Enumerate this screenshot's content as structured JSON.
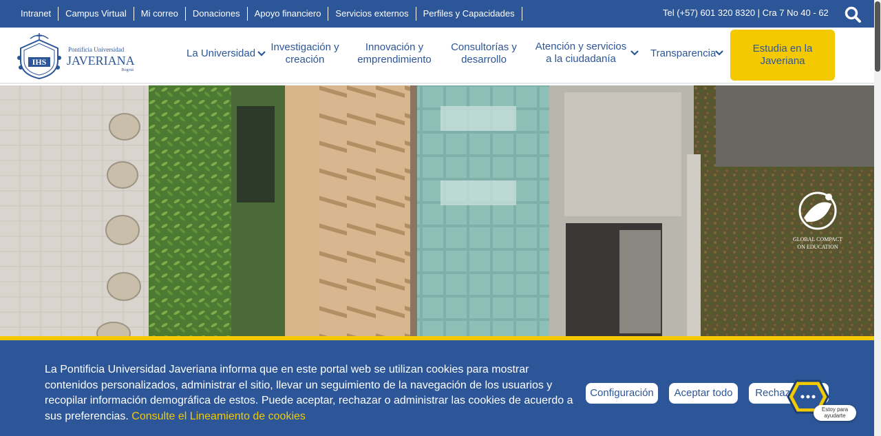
{
  "topbar": {
    "links": [
      "Intranet",
      "Campus Virtual",
      "Mi correo",
      "Donaciones",
      "Apoyo financiero",
      "Servicios externos",
      "Perfiles y Capacidades"
    ],
    "contact": "Tel (+57) 601 320 8320 | Cra 7 No 40 - 62",
    "search_icon": "search-icon"
  },
  "logo": {
    "line1": "Pontificia Universidad",
    "line2": "JAVERIANA",
    "line3": "Bogotá",
    "monogram": "IHS"
  },
  "nav": {
    "items": [
      {
        "label_1": "La Universidad",
        "label_2": "",
        "has_dropdown": true
      },
      {
        "label_1": "Investigación y",
        "label_2": "creación",
        "has_dropdown": false
      },
      {
        "label_1": "Innovación y",
        "label_2": "emprendimiento",
        "has_dropdown": false
      },
      {
        "label_1": "Consultorías y",
        "label_2": "desarrollo",
        "has_dropdown": false
      },
      {
        "label_1": "Atención y servicios",
        "label_2": "a la ciudadanía",
        "has_dropdown": true
      },
      {
        "label_1": "Transparencia",
        "label_2": "",
        "has_dropdown": true
      }
    ],
    "cta": "Estudia en la Javeriana"
  },
  "hero": {
    "badge_line1": "GLOBAL COMPACT",
    "badge_line2": "ON EDUCATION"
  },
  "cookie": {
    "text": "La Pontificia Universidad Javeriana informa que en este portal web se utilizan cookies para mostrar contenidos personalizados, administrar el sitio, llevar un seguimiento de la navegación de los usuarios y recopilar información demográfica de estos. Puede aceptar, rechazar o administrar las cookies de acuerdo a sus preferencias.",
    "link": "Consulte el Lineamiento de cookies",
    "buttons": {
      "config": "Configuración",
      "accept": "Aceptar todo",
      "reject": "Rechazar todo"
    }
  },
  "chat": {
    "line1": "Estoy para",
    "line2": "ayudarte"
  },
  "colors": {
    "brand_blue": "#2c5697",
    "accent_yellow": "#f5c900"
  }
}
